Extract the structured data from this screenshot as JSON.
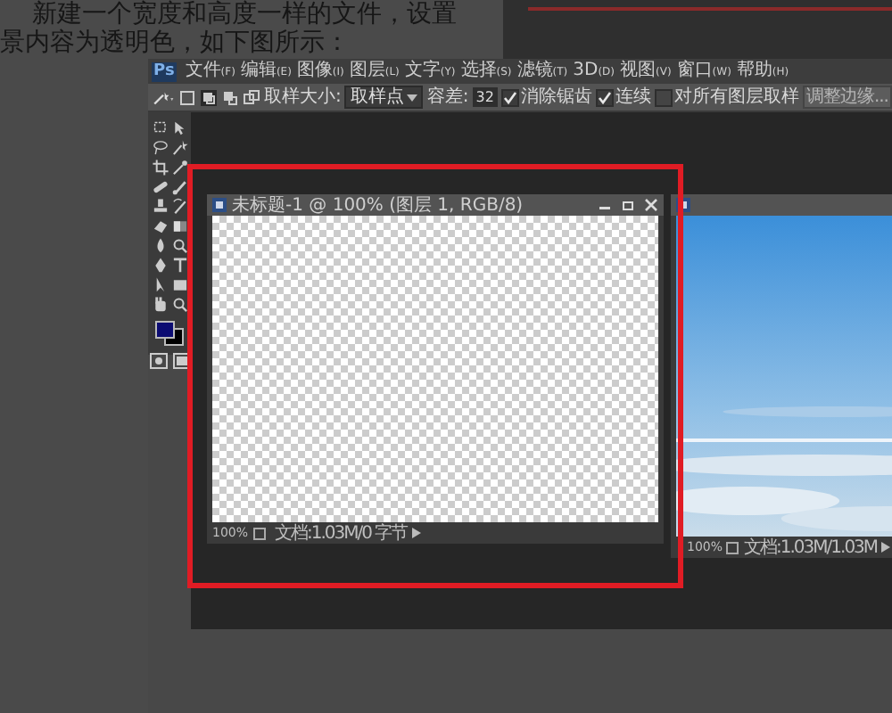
{
  "article": {
    "lines": [
      "新建一个宽度和高度一样的文件，设置",
      "景内容为透明色，如下图所示："
    ]
  },
  "app": {
    "logo": "Ps",
    "menu": [
      {
        "label": "文件",
        "hotkey": "(F)"
      },
      {
        "label": "编辑",
        "hotkey": "(E)"
      },
      {
        "label": "图像",
        "hotkey": "(I)"
      },
      {
        "label": "图层",
        "hotkey": "(L)"
      },
      {
        "label": "文字",
        "hotkey": "(Y)"
      },
      {
        "label": "选择",
        "hotkey": "(S)"
      },
      {
        "label": "滤镜",
        "hotkey": "(T)"
      },
      {
        "label": "3D",
        "hotkey": "(D)"
      },
      {
        "label": "视图",
        "hotkey": "(V)"
      },
      {
        "label": "窗口",
        "hotkey": "(W)"
      },
      {
        "label": "帮助",
        "hotkey": "(H)"
      }
    ],
    "options": {
      "sample_label": "取样大小:",
      "sample_value": "取样点",
      "tolerance_label": "容差:",
      "tolerance_value": "32",
      "checkboxes": [
        {
          "label": "消除锯齿",
          "checked": true
        },
        {
          "label": "连续",
          "checked": true
        },
        {
          "label": "对所有图层取样",
          "checked": false
        }
      ],
      "button": "调整边缘..."
    },
    "documents": [
      {
        "kind": "transparent",
        "title": "未标题-1 @ 100% (图层 1, RGB/8)",
        "zoom": "100%",
        "info": "文档:1.03M/0 字节"
      },
      {
        "kind": "picture",
        "zoom": "100%",
        "info": "文档:1.03M/1.03M"
      }
    ]
  }
}
